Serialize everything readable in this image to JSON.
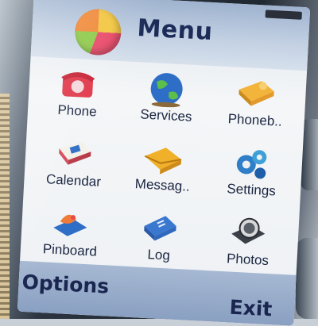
{
  "header": {
    "title": "Menu",
    "icon": "menu-icon"
  },
  "menu_items": [
    {
      "label": "Phone",
      "icon": "phone-icon"
    },
    {
      "label": "Services",
      "icon": "globe-icon"
    },
    {
      "label": "Phoneb..",
      "icon": "phonebook-icon"
    },
    {
      "label": "Calendar",
      "icon": "calendar-icon"
    },
    {
      "label": "Messag..",
      "icon": "envelope-icon"
    },
    {
      "label": "Settings",
      "icon": "gears-icon"
    },
    {
      "label": "Pinboard",
      "icon": "pinboard-icon"
    },
    {
      "label": "Log",
      "icon": "log-book-icon"
    },
    {
      "label": "Photos",
      "icon": "camera-icon"
    }
  ],
  "softkeys": {
    "left": "Options",
    "right": "Exit"
  }
}
